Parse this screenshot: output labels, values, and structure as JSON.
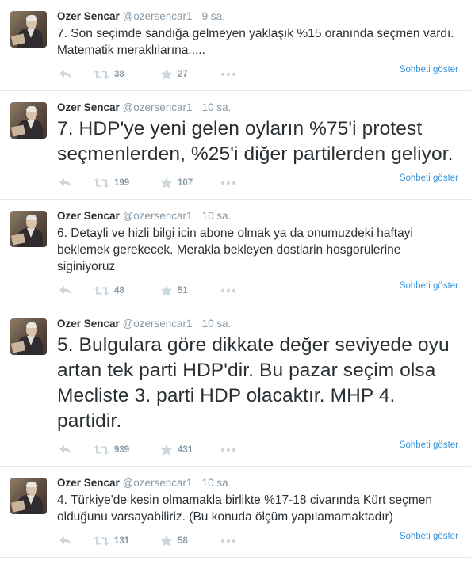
{
  "colors": {
    "link": "#3b94d9",
    "muted": "#8899a6",
    "text": "#292f33",
    "divider": "#e1e8ed"
  },
  "icons": {
    "reply": "reply-icon",
    "retweet": "retweet-icon",
    "favorite": "star-icon",
    "more": "more-icon"
  },
  "tweets": [
    {
      "name": "Ozer Sencar",
      "handle": "@ozersencar1",
      "dot": "·",
      "time": "9 sa.",
      "text": "7.  Son seçimde sandığa gelmeyen yaklaşık %15 oranında seçmen vardı. Matematik meraklılarına.....",
      "retweets": "38",
      "favorites": "27",
      "convo": "Sohbeti göster"
    },
    {
      "name": "Ozer Sencar",
      "handle": "@ozersencar1",
      "dot": "·",
      "time": "10 sa.",
      "text": "7. HDP'ye yeni gelen oyların %75'i protest seçmenlerden, %25'i diğer partilerden geliyor.",
      "retweets": "199",
      "favorites": "107",
      "convo": "Sohbeti göster"
    },
    {
      "name": "Ozer Sencar",
      "handle": "@ozersencar1",
      "dot": "·",
      "time": "10 sa.",
      "text": "6. Detayli ve hizli bilgi icin abone olmak ya da onumuzdeki haftayi beklemek gerekecek. Merakla bekleyen dostlarin hosgorulerine siginiyoruz",
      "retweets": "48",
      "favorites": "51",
      "convo": "Sohbeti göster"
    },
    {
      "name": "Ozer Sencar",
      "handle": "@ozersencar1",
      "dot": "·",
      "time": "10 sa.",
      "text": "5. Bulgulara göre dikkate değer seviyede oyu artan tek parti HDP'dir. Bu pazar seçim olsa Mecliste 3. parti HDP olacaktır. MHP 4. partidir.",
      "retweets": "939",
      "favorites": "431",
      "convo": "Sohbeti göster"
    },
    {
      "name": "Ozer Sencar",
      "handle": "@ozersencar1",
      "dot": "·",
      "time": "10 sa.",
      "text": "4. Türkiye'de kesin olmamakla birlikte %17-18 civarında Kürt seçmen olduğunu varsayabiliriz. (Bu konuda ölçüm yapılamamaktadır)",
      "retweets": "131",
      "favorites": "58",
      "convo": "Sohbeti göster"
    }
  ]
}
